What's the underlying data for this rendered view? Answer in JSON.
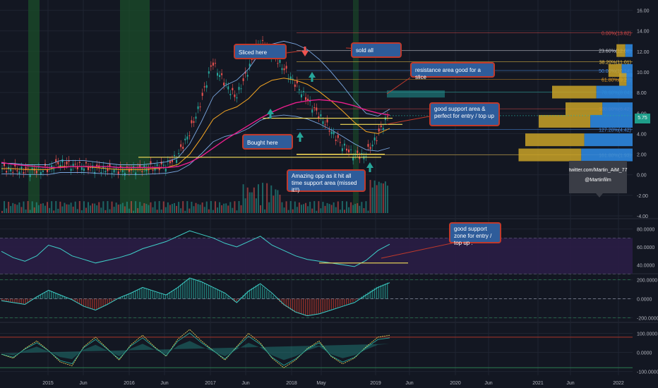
{
  "chart_data": {
    "type": "line",
    "x_labels": [
      "2015",
      "Jun",
      "2016",
      "Jun",
      "2017",
      "Jun",
      "2018",
      "May",
      "2019",
      "Jun",
      "2020",
      "Jun",
      "2021",
      "Jun",
      "2022"
    ],
    "panes": [
      {
        "name": "price",
        "y_ticks": [
          "16.00",
          "14.00",
          "12.00",
          "10.00",
          "8.00",
          "6.00",
          "4.00",
          "2.00",
          "0.00",
          "-2.00",
          "-4.00"
        ],
        "ylim": [
          -4,
          17
        ],
        "last_price": "5.75"
      },
      {
        "name": "rsi",
        "y_ticks": [
          "80.0000",
          "60.0000",
          "40.0000"
        ],
        "ylim": [
          30,
          90
        ]
      },
      {
        "name": "oscillator",
        "y_ticks": [
          "200.0000",
          "0.0000",
          "-200.0000"
        ],
        "ylim": [
          -250,
          250
        ]
      },
      {
        "name": "oscillator2",
        "y_ticks": [
          "100.0000",
          "0.0000",
          "-100.0000"
        ],
        "ylim": [
          -120,
          150
        ]
      }
    ],
    "series": [
      {
        "values": [
          0.6,
          0.5,
          0.4,
          0.4,
          0.6,
          1.2,
          0.9,
          0.8,
          0.6,
          0.5,
          0.4,
          0.5,
          0.6,
          0.7,
          0.9,
          1.8,
          4.0,
          7.0,
          11.0,
          9.0,
          7.5,
          10.0,
          13.0,
          12.0,
          10.5,
          9.0,
          7.5,
          6.0,
          4.5,
          3.0,
          2.0,
          1.8,
          3.5,
          5.7
        ]
      },
      {
        "values": [
          0.6,
          0.6,
          0.5,
          0.5,
          0.5,
          0.8,
          0.8,
          0.8,
          0.7,
          0.6,
          0.5,
          0.5,
          0.5,
          0.6,
          0.7,
          1.0,
          2.0,
          3.6,
          5.4,
          6.2,
          6.6,
          7.4,
          8.6,
          9.2,
          9.4,
          9.2,
          8.8,
          8.1,
          7.2,
          6.2,
          5.1,
          4.2,
          4.0,
          4.5
        ]
      },
      {
        "values": [
          1.2,
          1.0,
          0.9,
          0.8,
          0.7,
          0.7,
          0.8,
          0.8,
          0.8,
          0.8,
          0.7,
          0.7,
          0.7,
          0.7,
          0.7,
          0.8,
          1.2,
          1.8,
          2.6,
          3.4,
          4.1,
          4.8,
          5.5,
          6.1,
          6.6,
          7.0,
          7.2,
          7.3,
          7.2,
          7.0,
          6.7,
          6.3,
          6.0,
          5.8
        ]
      },
      {
        "values": [
          55,
          48,
          44,
          50,
          62,
          58,
          50,
          46,
          42,
          45,
          48,
          52,
          58,
          62,
          66,
          72,
          78,
          74,
          70,
          64,
          60,
          66,
          72,
          62,
          56,
          50,
          46,
          44,
          42,
          40,
          38,
          45,
          56,
          63
        ]
      },
      {
        "values": [
          -20,
          -40,
          -60,
          20,
          90,
          40,
          -10,
          -80,
          -120,
          -60,
          10,
          60,
          120,
          80,
          40,
          120,
          220,
          180,
          120,
          60,
          -40,
          80,
          160,
          60,
          -60,
          -140,
          -180,
          -160,
          -120,
          -80,
          -40,
          40,
          120,
          170
        ]
      },
      {
        "values": [
          -10,
          -30,
          20,
          60,
          10,
          -50,
          -70,
          30,
          80,
          20,
          -40,
          40,
          90,
          30,
          -20,
          70,
          120,
          60,
          10,
          -40,
          30,
          100,
          50,
          -30,
          -80,
          -40,
          20,
          60,
          -20,
          -60,
          -30,
          30,
          80,
          90
        ]
      }
    ],
    "fib_levels": [
      {
        "label": "0.00%(13.82)",
        "value": 13.82,
        "color": "#d84a4a"
      },
      {
        "label": "23.60%(12.08)",
        "value": 12.08,
        "color": "#d1d4dc"
      },
      {
        "label": "38.20%(11.01)",
        "value": 11.01,
        "color": "#f7c948"
      },
      {
        "label": "50.00%(10.14)",
        "value": 10.14,
        "color": "#4a8fe7"
      },
      {
        "label": "61.80%(9.27)",
        "value": 9.27,
        "color": "#f5a623"
      },
      {
        "label": "78.60%(8.04)",
        "value": 8.04,
        "color": "#2bb5a6"
      },
      {
        "label": "100.00%(6.42)",
        "value": 6.42,
        "color": "#d84a4a"
      },
      {
        "label": "127.20%(4.42)",
        "value": 4.42,
        "color": "#4a8fe7"
      },
      {
        "label": "161.80%(1.93)",
        "value": 1.93,
        "color": "#f7c948"
      }
    ],
    "volume_profile": [
      {
        "value": 12.08,
        "size": 0.12
      },
      {
        "value": 10.14,
        "size": 0.18
      },
      {
        "value": 9.27,
        "size": 0.1
      },
      {
        "value": 8.04,
        "size": 0.6
      },
      {
        "value": 6.42,
        "size": 0.5
      },
      {
        "value": 5.2,
        "size": 0.7
      },
      {
        "value": 3.4,
        "size": 0.8
      },
      {
        "value": 1.93,
        "size": 0.85
      }
    ],
    "grid": true
  },
  "annotations": {
    "sliced_here": "Sliced here",
    "sold_all": "sold all",
    "resistance": "resistance area good for a slice",
    "support_perfect": "good support area & perfect for entry / top up",
    "bought_here": "Bought here",
    "amazing_opp": "Amazing opp as it hit all time support area (missed it!!)",
    "support_zone": "good support zone for entry / top up ."
  },
  "watermark": {
    "twitter": "twitter.com/Martin_AiM_77",
    "handle": "@Martinfilm"
  },
  "colors": {
    "background": "#131722",
    "candle_up": "#26a69a",
    "candle_down": "#ef5350",
    "ma_magenta": "#e91e8c",
    "ma_orange": "#f5a623",
    "band_blue": "#7aa6e0",
    "yellow_line": "#f7e05a",
    "rsi_band": "#2a1d45",
    "rsi_line": "#3fd0c9"
  }
}
